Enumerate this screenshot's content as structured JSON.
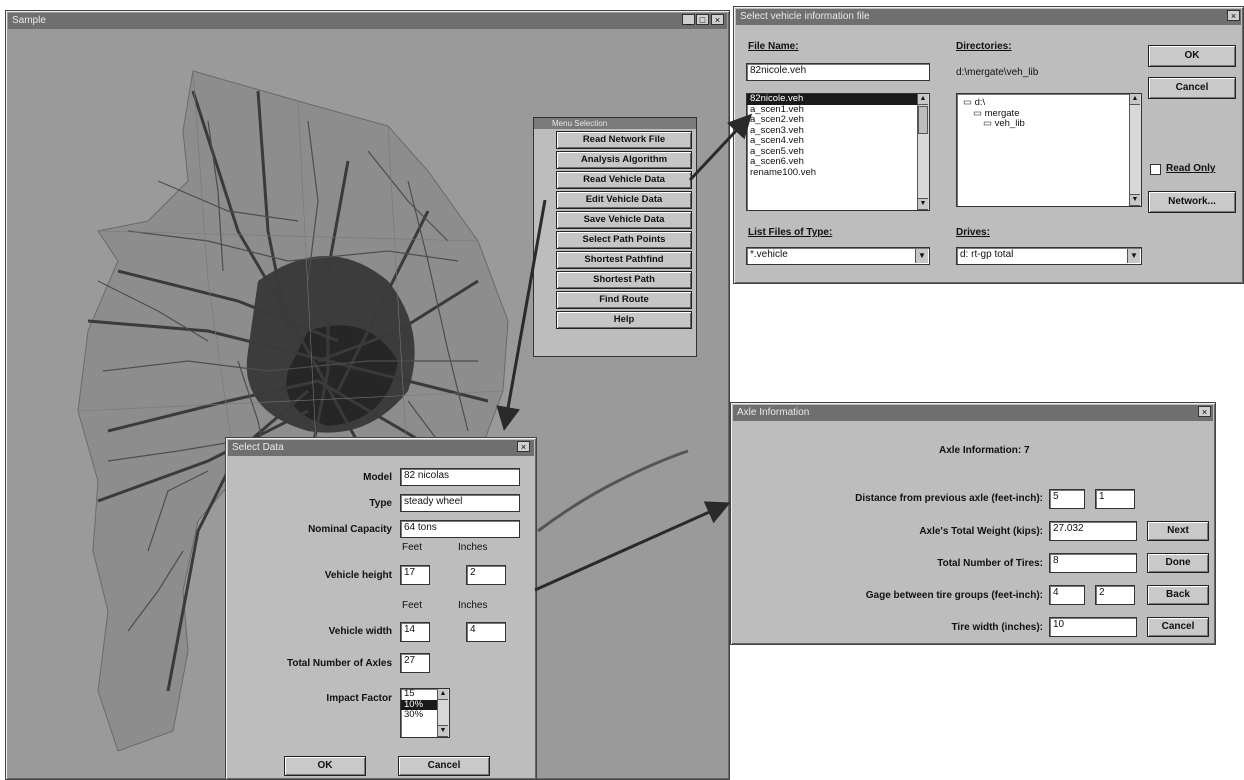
{
  "map_window": {
    "title": "Sample",
    "min_btn": "_",
    "max_btn": "□",
    "close_btn": "×"
  },
  "menu": {
    "title": "Menu Selection",
    "items": [
      "Read Network File",
      "Analysis Algorithm",
      "Read Vehicle Data",
      "Edit Vehicle Data",
      "Save Vehicle Data",
      "Select Path Points",
      "Shortest Pathfind",
      "Shortest Path",
      "Find Route",
      "Help"
    ]
  },
  "file_dialog": {
    "title": "Select vehicle information file",
    "file_name_label": "File Name:",
    "file_name_value": "82nicole.veh",
    "files": [
      "82nicole.veh",
      "a_scen1.veh",
      "a_scen2.veh",
      "a_scen3.veh",
      "a_scen4.veh",
      "a_scen5.veh",
      "a_scen6.veh",
      "rename100.veh"
    ],
    "directories_label": "Directories:",
    "current_dir": "d:\\mergate\\veh_lib",
    "dirs": [
      "d:\\",
      "mergate",
      "veh_lib"
    ],
    "ok": "OK",
    "cancel": "Cancel",
    "read_only": "Read Only",
    "network": "Network...",
    "type_label": "List Files of Type:",
    "type_value": "*.vehicle",
    "drives_label": "Drives:",
    "drive_value": "d: rt-gp total",
    "close_btn": "×"
  },
  "vehicle_dialog": {
    "title": "Select Data",
    "model_label": "Model",
    "model_value": "82 nicolas",
    "type_label": "Type",
    "type_value": "steady wheel",
    "capacity_label": "Nominal Capacity",
    "capacity_value": "64 tons",
    "feet_header": "Feet",
    "inches_header": "Inches",
    "height_label": "Vehicle height",
    "height_feet": "17",
    "height_inches": "2",
    "width_label": "Vehicle width",
    "width_feet": "14",
    "width_inches": "4",
    "axles_label": "Total Number of Axles",
    "axles_value": "27",
    "impact_label": "Impact Factor",
    "impact_options": [
      "15",
      "10%",
      "30%"
    ],
    "ok": "OK",
    "cancel": "Cancel",
    "close_btn": "×"
  },
  "axle_dialog": {
    "title": "Axle Information",
    "heading": "Axle Information: 7",
    "distance_label": "Distance from previous axle (feet-inch):",
    "distance_feet": "5",
    "distance_inches": "1",
    "weight_label": "Axle's Total Weight (kips):",
    "weight_value": "27.032",
    "tires_label": "Total Number of Tires:",
    "tires_value": "8",
    "gage_label": "Gage between tire groups (feet-inch):",
    "gage_feet": "4",
    "gage_inches": "2",
    "tire_width_label": "Tire width (inches):",
    "tire_width_value": "10",
    "next": "Next",
    "done": "Done",
    "back": "Back",
    "cancel": "Cancel",
    "close_btn": "×"
  },
  "colors": {
    "map_bg": "#9a9a9a",
    "dialog_bg": "#bdbdbd",
    "titlebar": "#6f6f6f",
    "selection": "#1a1a1a"
  }
}
